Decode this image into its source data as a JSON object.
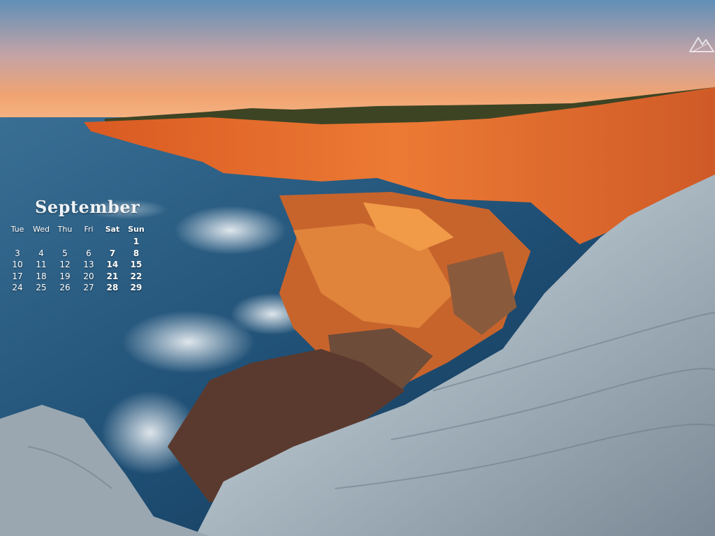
{
  "calendar": {
    "month": "September",
    "weekday_headers": [
      "",
      "Tue",
      "Wed",
      "Thu",
      "Fri",
      "Sat",
      "Sun"
    ],
    "weeks": [
      [
        "",
        "",
        "",
        "",
        "",
        "",
        "1"
      ],
      [
        "",
        "3",
        "4",
        "5",
        "6",
        "7",
        "8"
      ],
      [
        "",
        "10",
        "11",
        "12",
        "13",
        "14",
        "15"
      ],
      [
        "",
        "17",
        "18",
        "19",
        "20",
        "21",
        "22"
      ],
      [
        "",
        "24",
        "25",
        "26",
        "27",
        "28",
        "29"
      ]
    ]
  },
  "wallpaper": {
    "subject": "sandstone sea cliffs at sunset",
    "colors": {
      "sky_top": "#5f8fb7",
      "sky_bottom": "#f1a46f",
      "ocean": "#1f4f75",
      "cliff_lit": "#e36a2a",
      "rock_pale": "#c9d2d8"
    }
  },
  "brand_mark": {
    "icon": "mountain-logo-icon"
  }
}
